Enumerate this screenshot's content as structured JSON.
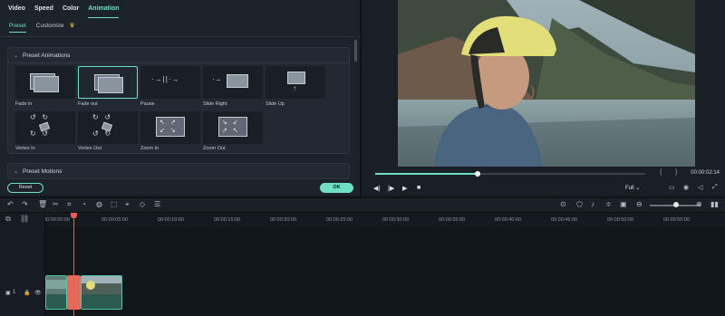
{
  "tabs": [
    "Video",
    "Speed",
    "Color",
    "Animation"
  ],
  "active_tab": "Animation",
  "subtabs": [
    "Preset",
    "Customize"
  ],
  "crown_icon": "crown-icon",
  "preset_animations": {
    "title": "Preset Animations",
    "items": [
      "Fade in",
      "Fade out",
      "Pause",
      "Slide Right",
      "Slide Up",
      "Vortex In",
      "Vortex Out",
      "Zoom In",
      "Zoom Out"
    ],
    "selected": "Fade out"
  },
  "preset_motions": {
    "title": "Preset Motions"
  },
  "buttons": {
    "reset": "Reset",
    "ok": "OK"
  },
  "preview": {
    "timecode": "00:00:02:14",
    "progress": 0.38,
    "quality": "Full",
    "pause_glyph": "||"
  },
  "ruler_ticks": [
    "00:00:00:00",
    "00:00:05:00",
    "00:00:10:00",
    "00:00:15:00",
    "00:00:20:00",
    "00:00:25:00",
    "00:00:30:00",
    "00:00:35:00",
    "00:00:40:00",
    "00:00:45:00",
    "00:00:50:00",
    "00:00:55:00"
  ],
  "track": {
    "label": "1"
  },
  "colors": {
    "accent": "#6fe0c4",
    "playhead": "#ee5a5a",
    "panel": "#1d232b"
  }
}
